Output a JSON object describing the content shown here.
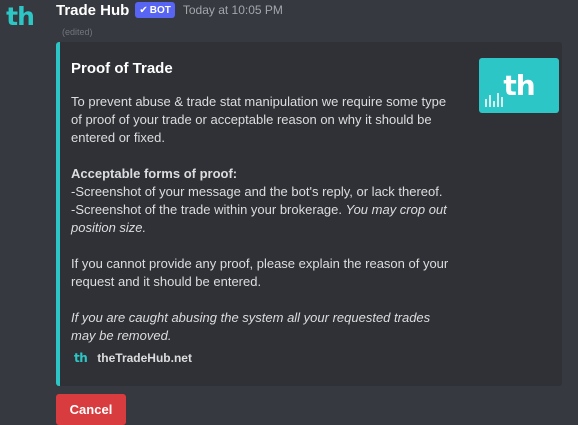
{
  "message": {
    "avatar_text": "th",
    "username": "Trade Hub",
    "bot_tag": "BOT",
    "timestamp": "Today at 10:05 PM",
    "edited": "(edited)"
  },
  "embed": {
    "accent_color": "#2dc6c6",
    "title": "Proof of Trade",
    "thumbnail_text": "th",
    "intro": "To prevent abuse & trade stat manipulation we require some type of proof of your trade or acceptable reason on why it should be entered or fixed.",
    "forms_heading": "Acceptable forms of proof:",
    "form_1": "-Screenshot of your message and the bot's reply, or lack thereof.",
    "form_2": "-Screenshot of the trade within your brokerage.",
    "form_2_note": "You may crop out position size.",
    "no_proof": "If you cannot provide any proof, please explain the reason of your request and it should be entered.",
    "warning": "If you are caught abusing the system all your requested trades may be removed.",
    "footer_icon_text": "th",
    "footer_text": "theTradeHub.net"
  },
  "buttons": {
    "cancel_label": "Cancel",
    "cancel_color": "#d83c3e"
  }
}
